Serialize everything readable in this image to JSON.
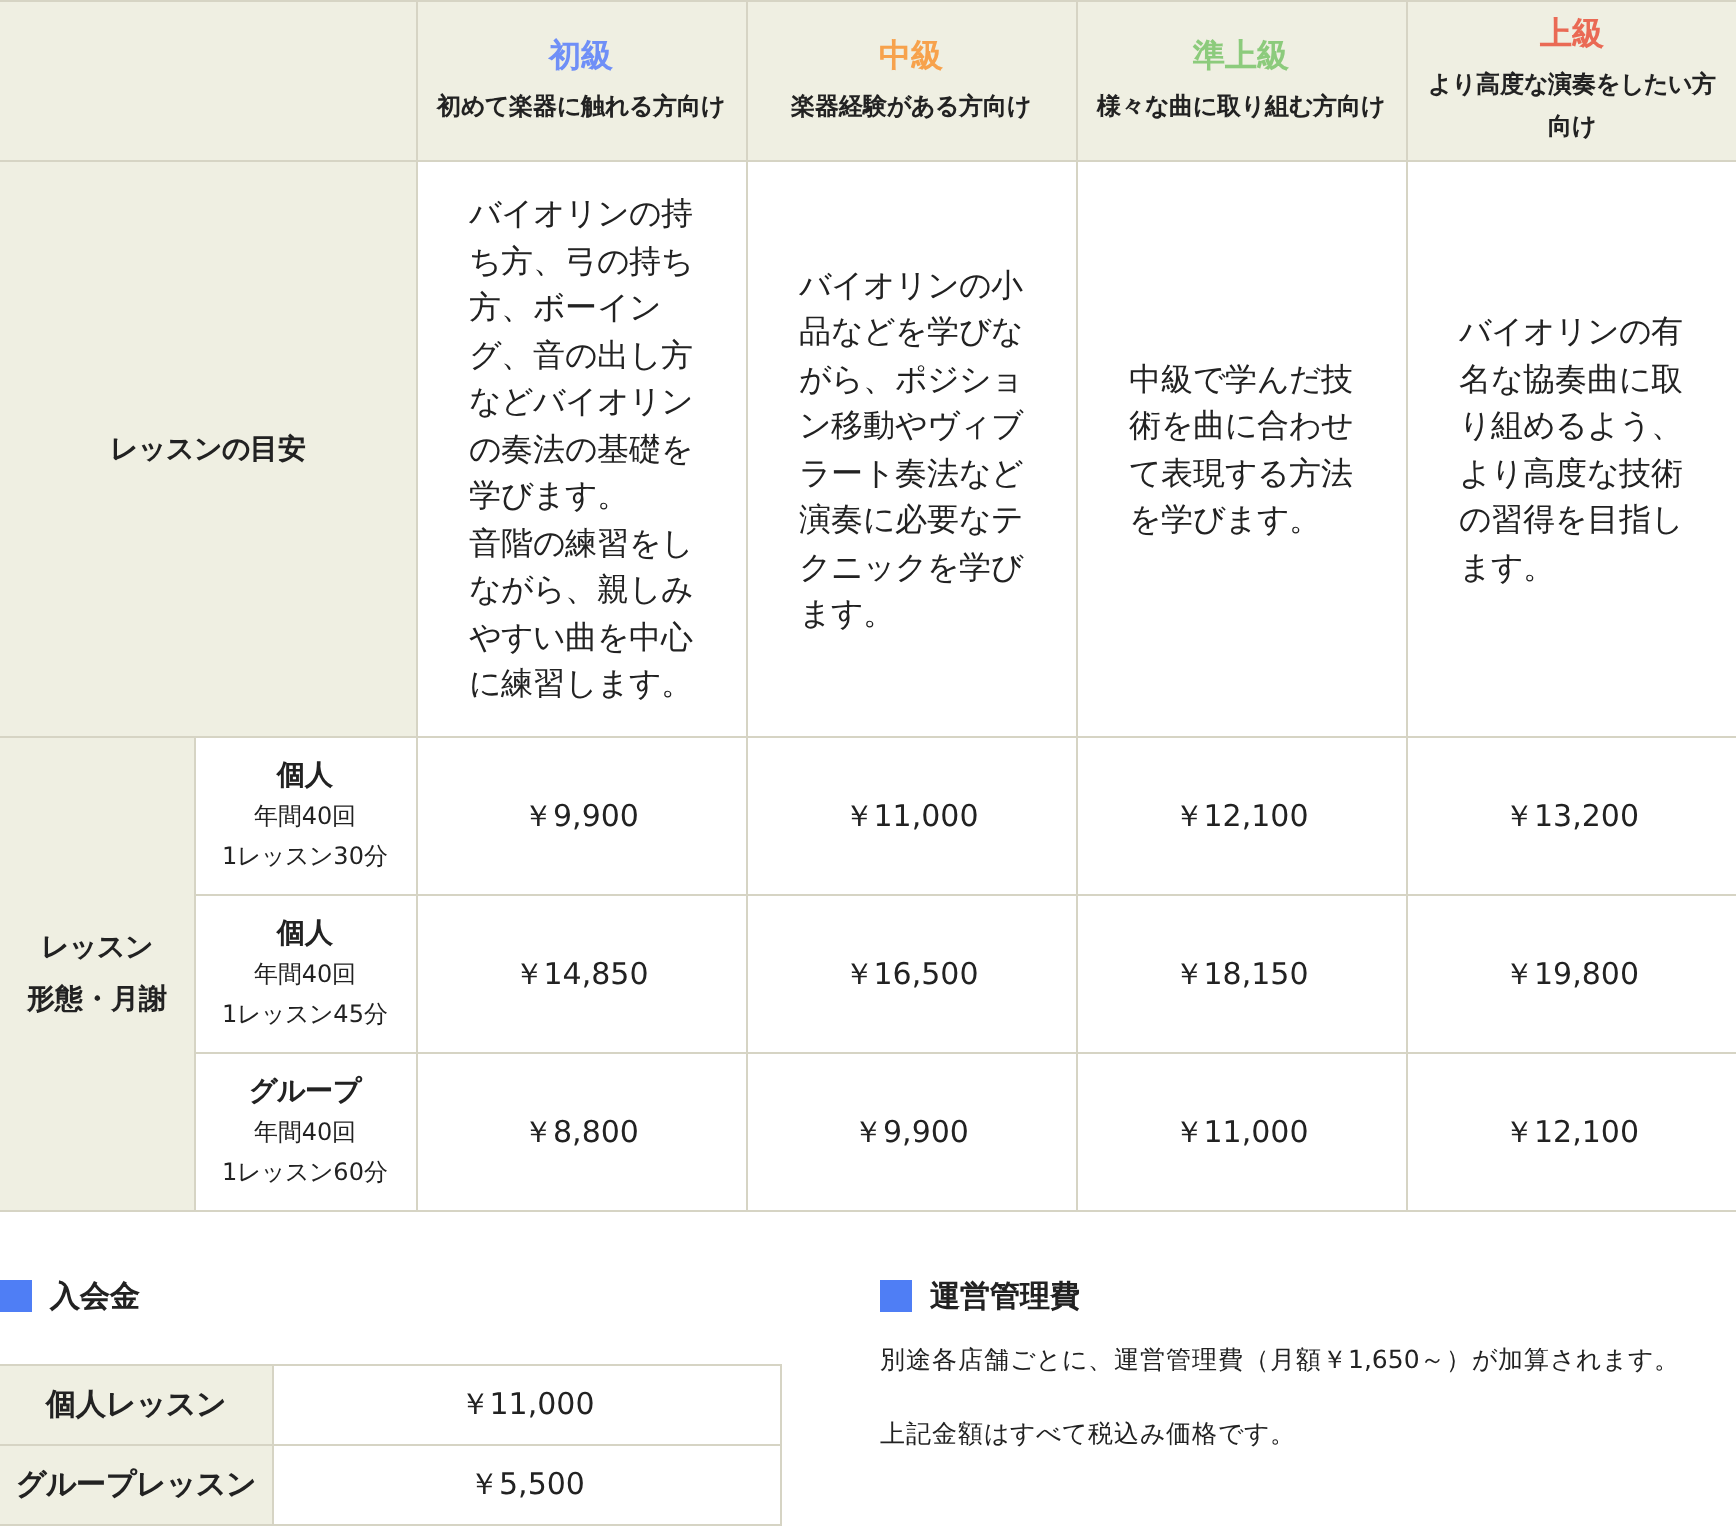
{
  "levels": [
    {
      "name": "初級",
      "color": "#6f8ff7",
      "desc": "初めて楽器に触れる方向け"
    },
    {
      "name": "中級",
      "color": "#f7a24c",
      "desc": "楽器経験がある方向け"
    },
    {
      "name": "準上級",
      "color": "#8ccb7c",
      "desc": "様々な曲に取り組む方向け"
    },
    {
      "name": "上級",
      "color": "#ea6a55",
      "desc": "より高度な演奏をしたい方向け"
    }
  ],
  "goal_row": {
    "label": "レッスンの目安",
    "cells": [
      [
        "バイオリンの持ち方、弓の持ち方、ボーイング、音の出し方などバイオリンの奏法の基礎を学びます。",
        "音階の練習をしながら、親しみやすい曲を中心に練習します。"
      ],
      [
        "バイオリンの小品などを学びながら、ポジション移動やヴィブラート奏法など演奏に必要なテクニックを学びます。"
      ],
      [
        "中級で学んだ技術を曲に合わせて表現する方法を学びます。"
      ],
      [
        "バイオリンの有名な協奏曲に取り組めるよう、より高度な技術の習得を目指します。"
      ]
    ]
  },
  "fee_group": {
    "label_lines": [
      "レッスン",
      "形態・月謝"
    ],
    "rows": [
      {
        "type": "個人",
        "count": "年間40回",
        "duration": "1レッスン30分",
        "prices": [
          "￥9,900",
          "￥11,000",
          "￥12,100",
          "￥13,200"
        ]
      },
      {
        "type": "個人",
        "count": "年間40回",
        "duration": "1レッスン45分",
        "prices": [
          "￥14,850",
          "￥16,500",
          "￥18,150",
          "￥19,800"
        ]
      },
      {
        "type": "グループ",
        "count": "年間40回",
        "duration": "1レッスン60分",
        "prices": [
          "￥8,800",
          "￥9,900",
          "￥11,000",
          "￥12,100"
        ]
      }
    ]
  },
  "admission": {
    "title": "入会金",
    "rows": [
      {
        "label": "個人レッスン",
        "price": "￥11,000"
      },
      {
        "label": "グループレッスン",
        "price": "￥5,500"
      }
    ]
  },
  "management": {
    "title": "運営管理費",
    "notes": [
      "別途各店舗ごとに、運営管理費（月額￥1,650～）が加算されます。",
      "上記金額はすべて税込み価格です。"
    ]
  }
}
